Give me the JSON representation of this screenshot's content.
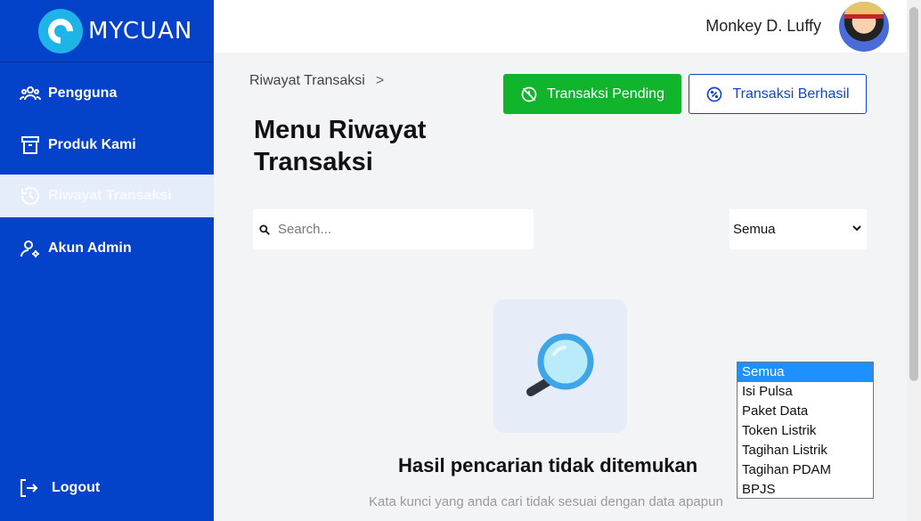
{
  "brand": {
    "name": "MYCUAN"
  },
  "sidebar": {
    "items": [
      {
        "label": "Pengguna",
        "icon": "users-icon"
      },
      {
        "label": "Produk Kami",
        "icon": "archive-box-icon"
      },
      {
        "label": "Riwayat Transaksi",
        "icon": "history-icon",
        "active": true
      },
      {
        "label": "Akun Admin",
        "icon": "user-cog-icon"
      }
    ],
    "logout": "Logout"
  },
  "header": {
    "user_name": "Monkey D. Luffy"
  },
  "main": {
    "breadcrumb": "Riwayat Transaksi",
    "breadcrumb_sep": ">",
    "title": "Menu Riwayat Transaksi",
    "buttons": {
      "pending": "Transaksi Pending",
      "success": "Transaksi Berhasil"
    },
    "search": {
      "placeholder": "Search...",
      "value": ""
    },
    "filter": {
      "selected": "Semua",
      "options": [
        "Semua",
        "Isi Pulsa",
        "Paket Data",
        "Token Listrik",
        "Tagihan Listrik",
        "Tagihan PDAM",
        "BPJS"
      ]
    },
    "empty": {
      "title": "Hasil pencarian tidak ditemukan",
      "subtitle": "Kata kunci yang anda cari tidak sesuai dengan data apapun"
    }
  },
  "colors": {
    "sidebar": "#0342c9",
    "pending": "#10b52c",
    "accent": "#1246c9",
    "dropdown_selected": "#1e90ff"
  }
}
